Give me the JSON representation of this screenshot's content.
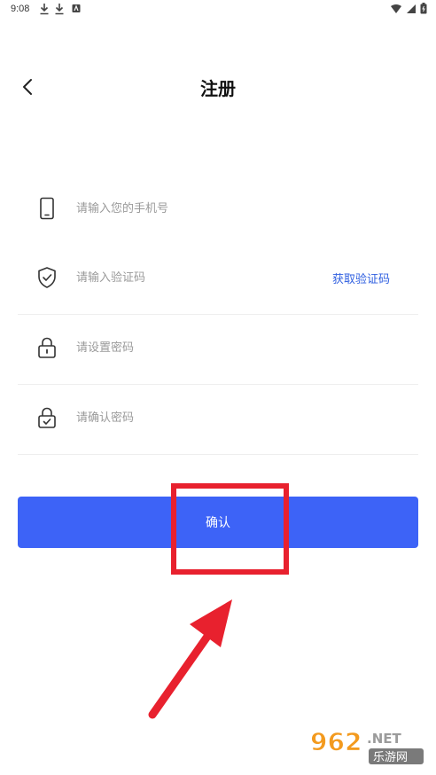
{
  "status_bar": {
    "time": "9:08"
  },
  "header": {
    "title": "注册",
    "back_icon": "chevron-left-icon"
  },
  "form": {
    "phone": {
      "icon": "phone-icon",
      "placeholder": "请输入您的手机号",
      "value": ""
    },
    "verification": {
      "icon": "shield-check-icon",
      "placeholder": "请输入验证码",
      "value": "",
      "get_code_label": "获取验证码"
    },
    "password": {
      "icon": "lock-icon",
      "placeholder": "请设置密码",
      "value": ""
    },
    "confirm_password": {
      "icon": "lock-check-icon",
      "placeholder": "请确认密码",
      "value": ""
    }
  },
  "confirm_button": {
    "label": "确认"
  },
  "colors": {
    "accent": "#3d63f7",
    "link": "#2f5fe0",
    "annotation": "#e8212e"
  },
  "watermark": {
    "text": "962.NET",
    "subtext": "乐游网"
  }
}
